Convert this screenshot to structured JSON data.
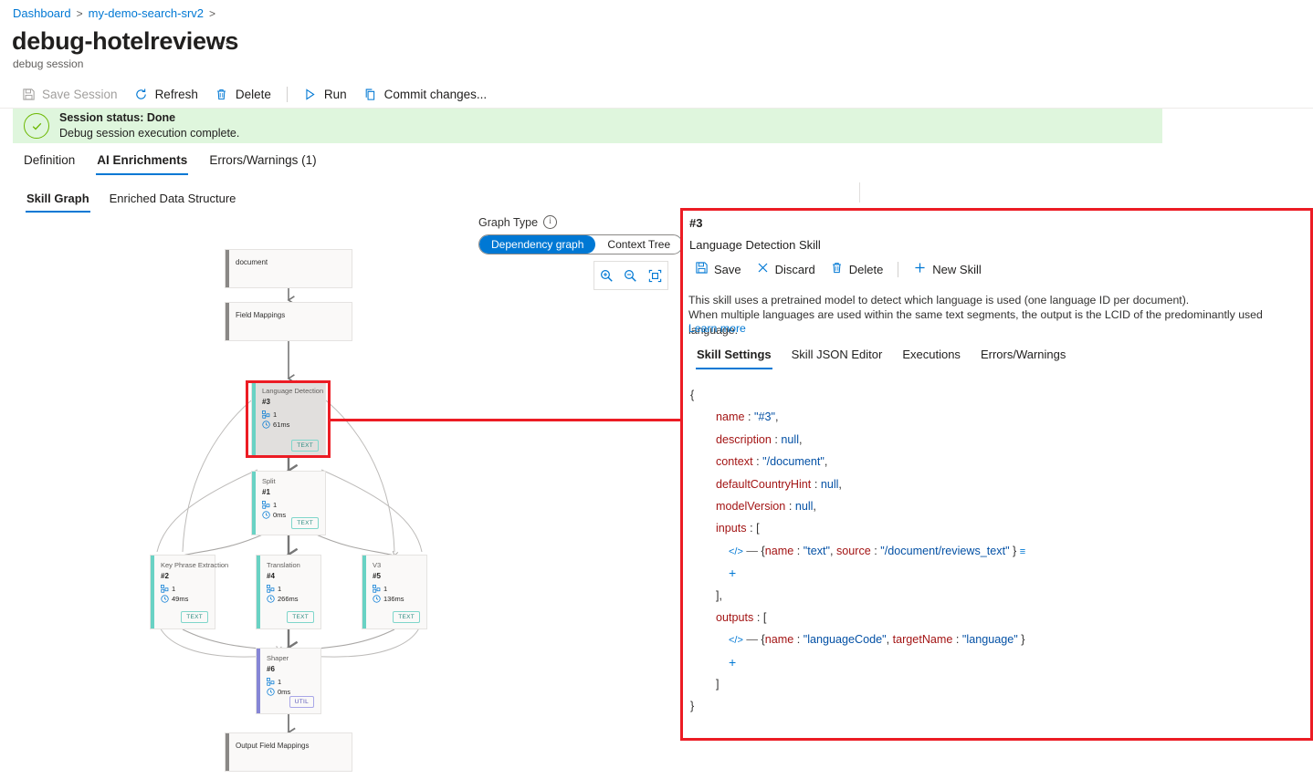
{
  "breadcrumb": {
    "items": [
      "Dashboard",
      "my-demo-search-srv2"
    ],
    "separator": ">"
  },
  "header": {
    "title": "debug-hotelreviews",
    "ellipsis": "···",
    "subtitle": "debug session"
  },
  "commandbar": {
    "save_session": "Save Session",
    "refresh": "Refresh",
    "delete": "Delete",
    "run": "Run",
    "commit": "Commit changes..."
  },
  "status": {
    "title": "Session status: Done",
    "subtitle": "Debug session execution complete.",
    "icon": "check-circle-icon",
    "background": "#dff6dd",
    "accent": "#6bb700"
  },
  "tabs_level1": [
    {
      "label": "Definition",
      "selected": false
    },
    {
      "label": "AI Enrichments",
      "selected": true
    },
    {
      "label": "Errors/Warnings (1)",
      "selected": false
    }
  ],
  "tabs_level2": [
    {
      "label": "Skill Graph",
      "selected": true
    },
    {
      "label": "Enriched Data Structure",
      "selected": false
    }
  ],
  "graph_controls": {
    "label": "Graph Type",
    "info_glyph": "i",
    "options": [
      {
        "label": "Dependency graph",
        "selected": true
      },
      {
        "label": "Context Tree",
        "selected": false
      }
    ],
    "zoom_in": "zoom-in-icon",
    "zoom_out": "zoom-out-icon",
    "fit": "fit-to-screen-icon"
  },
  "graph": {
    "nodes": [
      {
        "id": "document",
        "title": "document",
        "kind": "plain",
        "bar": "#8a8886"
      },
      {
        "id": "fieldmap",
        "title": "Field Mappings",
        "kind": "plain",
        "bar": "#8a8886"
      },
      {
        "id": "langdet",
        "title": "Language Detection",
        "num": "#3",
        "count": "1",
        "time": "61ms",
        "badge": "TEXT",
        "bar": "#69d2c4",
        "selected": true
      },
      {
        "id": "split",
        "title": "Split",
        "num": "#1",
        "count": "1",
        "time": "0ms",
        "badge": "TEXT",
        "bar": "#69d2c4"
      },
      {
        "id": "keyphrase",
        "title": "Key Phrase Extraction",
        "num": "#2",
        "count": "1",
        "time": "49ms",
        "badge": "TEXT",
        "bar": "#69d2c4"
      },
      {
        "id": "translate",
        "title": "Translation",
        "num": "#4",
        "count": "1",
        "time": "266ms",
        "badge": "TEXT",
        "bar": "#69d2c4"
      },
      {
        "id": "v3",
        "title": "V3",
        "num": "#5",
        "count": "1",
        "time": "136ms",
        "badge": "TEXT",
        "bar": "#69d2c4"
      },
      {
        "id": "shaper",
        "title": "Shaper",
        "num": "#6",
        "count": "1",
        "time": "0ms",
        "badge": "UTIL",
        "bar": "#8686d6"
      },
      {
        "id": "outmap",
        "title": "Output Field Mappings",
        "kind": "plain",
        "bar": "#8a8886"
      }
    ],
    "highlight_color": "#ec1c24"
  },
  "panel": {
    "skill_id": "#3",
    "skill_name": "Language Detection Skill",
    "commands": {
      "save": "Save",
      "discard": "Discard",
      "delete": "Delete",
      "new_skill": "New Skill"
    },
    "description_line1": "This skill uses a pretrained model to detect which language is used (one language ID per document).",
    "description_line2": "When multiple languages are used within the same text segments, the output is the LCID of the predominantly used language.",
    "learn_more": "Learn more",
    "tabs": [
      {
        "label": "Skill Settings",
        "selected": true
      },
      {
        "label": "Skill JSON Editor",
        "selected": false
      },
      {
        "label": "Executions",
        "selected": false
      },
      {
        "label": "Errors/Warnings",
        "selected": false
      }
    ],
    "json": {
      "open_brace": "{",
      "close_brace": "}",
      "fields": [
        {
          "key": "name",
          "colon": ":",
          "value": "\"#3\"",
          "comma": ","
        },
        {
          "key": "description",
          "colon": ":",
          "value": "null",
          "comma": ","
        },
        {
          "key": "context",
          "colon": ":",
          "value": "\"/document\"",
          "comma": ","
        },
        {
          "key": "defaultCountryHint",
          "colon": ":",
          "value": "null",
          "comma": ","
        },
        {
          "key": "modelVersion",
          "colon": ":",
          "value": "null",
          "comma": ","
        }
      ],
      "inputs": {
        "key": "inputs",
        "open": "[",
        "item_prefix": "{",
        "item_key1": "name",
        "item_val1": "\"text\"",
        "item_key2": "source",
        "item_val2": "\"/document/reviews_text\"",
        "item_suffix": "}",
        "add": "+",
        "close": "],"
      },
      "outputs": {
        "key": "outputs",
        "open": "[",
        "item_prefix": "{",
        "item_key1": "name",
        "item_val1": "\"languageCode\"",
        "item_key2": "targetName",
        "item_val2": "\"language\"",
        "item_suffix": "}",
        "add": "+",
        "close": "]"
      }
    }
  }
}
